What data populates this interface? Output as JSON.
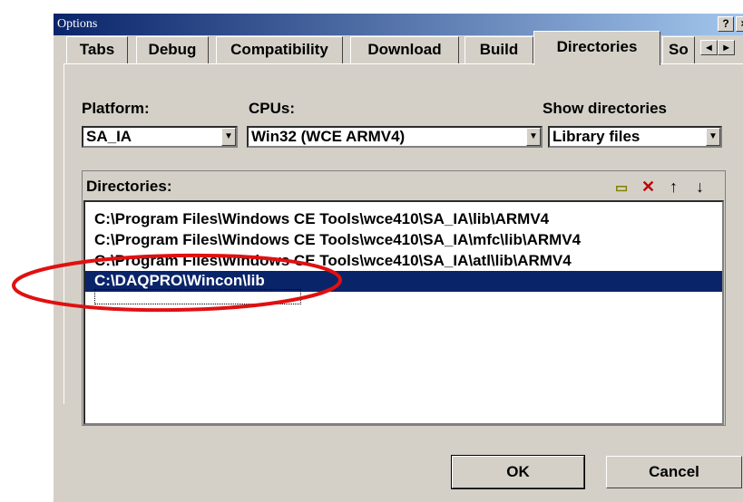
{
  "window": {
    "title": "Options",
    "help_label": "?",
    "close_label": "×"
  },
  "tabs": [
    {
      "label": "Tabs"
    },
    {
      "label": "Debug"
    },
    {
      "label": "Compatibility"
    },
    {
      "label": "Download"
    },
    {
      "label": "Build"
    },
    {
      "label": "Directories",
      "active": true
    },
    {
      "label": "So"
    }
  ],
  "platform": {
    "label": "Platform:",
    "value": "SA_IA"
  },
  "cpus": {
    "label": "CPUs:",
    "value": "Win32 (WCE ARMV4)"
  },
  "show_directories": {
    "label": "Show directories",
    "value": "Library files"
  },
  "directories": {
    "label": "Directories:",
    "items": [
      "C:\\Program Files\\Windows CE Tools\\wce410\\SA_IA\\lib\\ARMV4",
      "C:\\Program Files\\Windows CE Tools\\wce410\\SA_IA\\mfc\\lib\\ARMV4",
      "C:\\Program Files\\Windows CE Tools\\wce410\\SA_IA\\atl\\lib\\ARMV4",
      "C:\\DAQPRO\\Wincon\\lib"
    ],
    "selected_index": 3
  },
  "buttons": {
    "ok": "OK",
    "cancel": "Cancel"
  },
  "annotation": {
    "color": "#e01010"
  }
}
